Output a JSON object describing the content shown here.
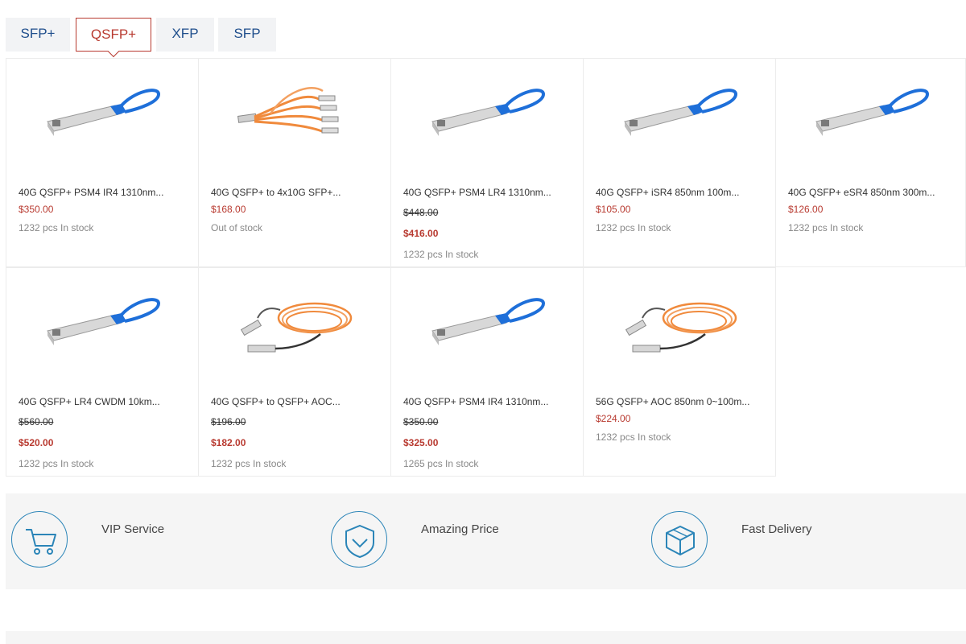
{
  "tabs": [
    {
      "label": "SFP+",
      "active": false
    },
    {
      "label": "QSFP+",
      "active": true
    },
    {
      "label": "XFP",
      "active": false
    },
    {
      "label": "SFP",
      "active": false
    }
  ],
  "products": [
    {
      "name": "40G QSFP+ PSM4 IR4 1310nm...",
      "price": "$350.00",
      "stock": "1232 pcs In stock",
      "image": "transceiver-blue-pull-tab"
    },
    {
      "name": "40G QSFP+ to 4x10G SFP+...",
      "price": "$168.00",
      "stock": "Out of stock",
      "image": "breakout-cable-orange"
    },
    {
      "name": "40G QSFP+ PSM4 LR4 1310nm...",
      "old_price": "$448.00",
      "price": "$416.00",
      "stock": "1232 pcs In stock",
      "image": "transceiver-blue-pull-tab"
    },
    {
      "name": "40G QSFP+ iSR4 850nm 100m...",
      "price": "$105.00",
      "stock": "1232 pcs In stock",
      "image": "transceiver-blue-pull-tab"
    },
    {
      "name": "40G QSFP+ eSR4 850nm 300m...",
      "price": "$126.00",
      "stock": "1232 pcs In stock",
      "image": "transceiver-blue-pull-tab"
    },
    {
      "name": "40G QSFP+ LR4 CWDM 10km...",
      "old_price": "$560.00",
      "price": "$520.00",
      "stock": "1232 pcs In stock",
      "image": "transceiver-blue-pull-tab"
    },
    {
      "name": "40G QSFP+ to QSFP+ AOC...",
      "old_price": "$196.00",
      "price": "$182.00",
      "stock": "1232 pcs In stock",
      "image": "aoc-cable-orange"
    },
    {
      "name": "40G QSFP+ PSM4 IR4 1310nm...",
      "old_price": "$350.00",
      "price": "$325.00",
      "stock": "1265 pcs In stock",
      "image": "transceiver-blue-pull-tab"
    },
    {
      "name": "56G QSFP+ AOC 850nm 0~100m...",
      "price": "$224.00",
      "stock": "1232 pcs In stock",
      "image": "aoc-cable-orange"
    }
  ],
  "features": [
    {
      "label": "VIP Service",
      "icon": "shopping-cart-icon"
    },
    {
      "label": "Amazing Price",
      "icon": "price-shield-icon"
    },
    {
      "label": "Fast Delivery",
      "icon": "delivery-box-icon"
    }
  ],
  "colors": {
    "accent_red": "#b83a30",
    "tab_blue": "#1f4e8c",
    "icon_blue": "#2b85b8",
    "cable_orange": "#f08a3c",
    "pull_tab_blue": "#1e6fd9"
  }
}
